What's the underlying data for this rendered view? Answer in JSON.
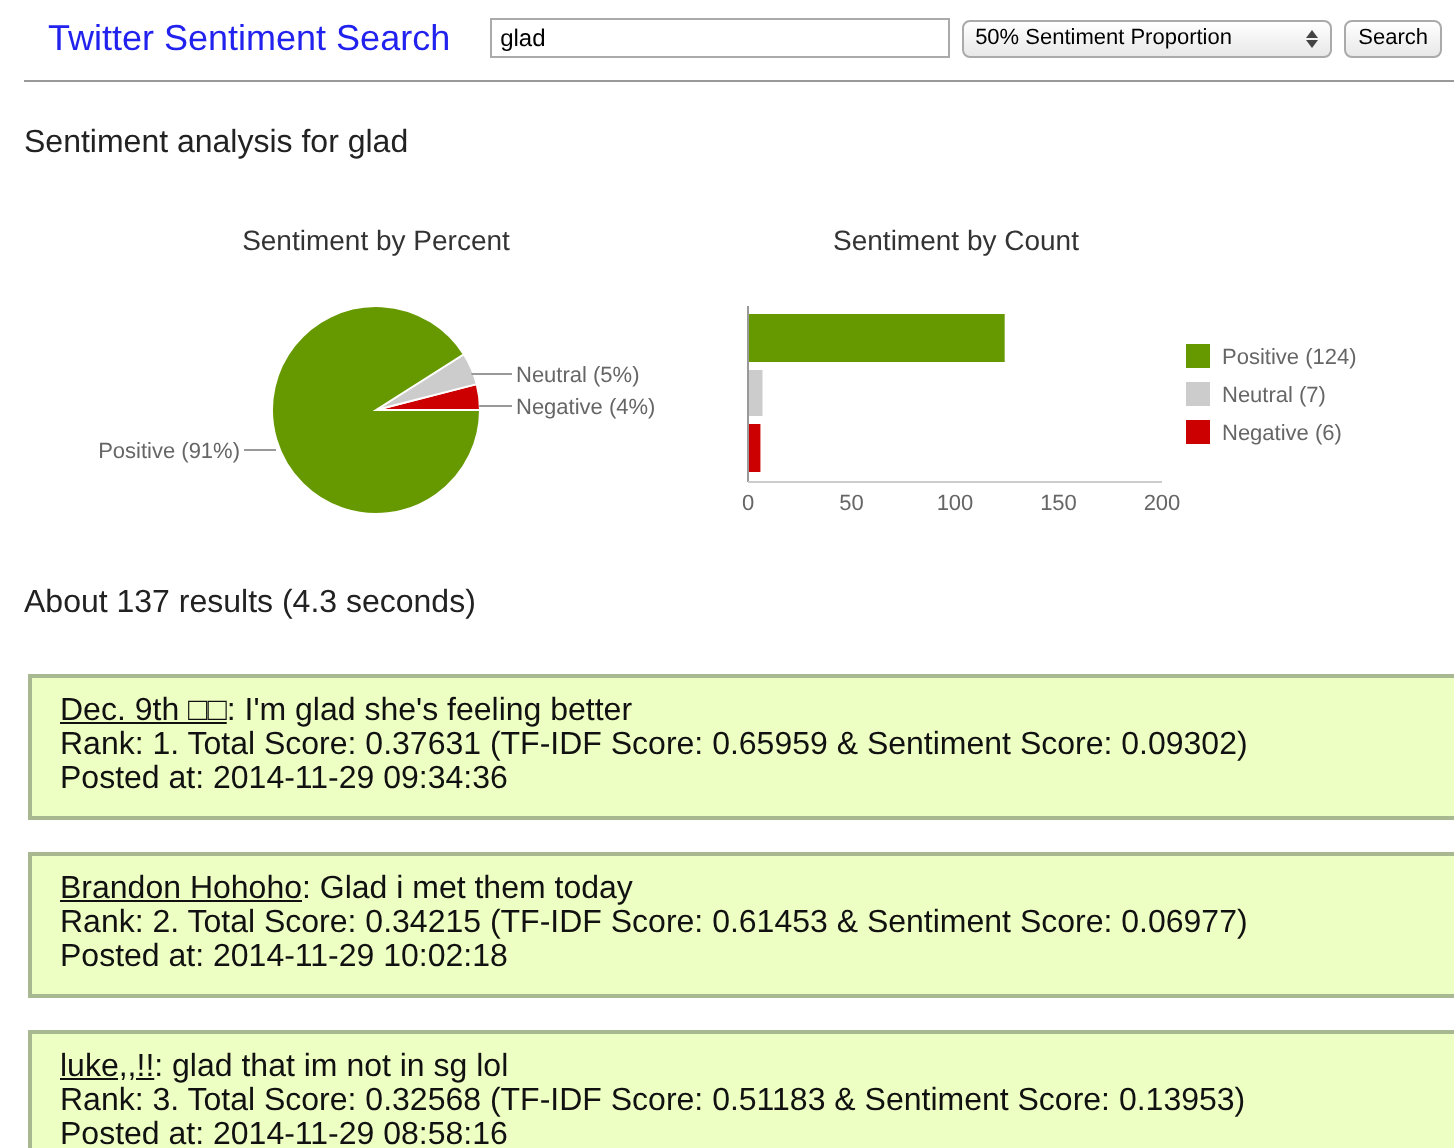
{
  "header": {
    "title": "Twitter Sentiment Search",
    "search": {
      "value": "glad"
    },
    "proportion_select": {
      "value": "50% Sentiment Proportion"
    },
    "search_button": "Search"
  },
  "analysis_heading": "Sentiment analysis for glad",
  "percent_chart": {
    "chart_data": {
      "type": "pie",
      "title": "Sentiment by Percent",
      "categories": [
        "Positive (91%)",
        "Neutral (5%)",
        "Negative (4%)"
      ],
      "series": [
        {
          "colors": [
            "#669900",
            "#cccccc",
            "#cc0000"
          ],
          "values": [
            91,
            5,
            4
          ]
        }
      ]
    }
  },
  "count_chart": {
    "chart_data": {
      "type": "bar",
      "orientation": "horizontal",
      "title": "Sentiment by Count",
      "categories": [
        "Positive (124)",
        "Neutral (7)",
        "Negative (6)"
      ],
      "series": [
        {
          "colors": [
            "#669900",
            "#cccccc",
            "#cc0000"
          ],
          "values": [
            124,
            7,
            6
          ]
        }
      ],
      "xlim": [
        0,
        200
      ],
      "xticks": [
        0,
        50,
        100,
        150,
        200
      ]
    }
  },
  "results_summary": "About 137 results (4.3 seconds)",
  "results": [
    {
      "user": "Dec. 9th □□",
      "text": ": I'm glad she's feeling better",
      "score_line": "Rank: 1. Total Score: 0.37631 (TF-IDF Score: 0.65959 & Sentiment Score: 0.09302)",
      "posted": "Posted at: 2014-11-29 09:34:36"
    },
    {
      "user": "Brandon Hohoho",
      "text": ": Glad i met them today",
      "score_line": "Rank: 2. Total Score: 0.34215 (TF-IDF Score: 0.61453 & Sentiment Score: 0.06977)",
      "posted": "Posted at: 2014-11-29 10:02:18"
    },
    {
      "user": "luke,,!!",
      "text": ": glad that im not in sg lol",
      "score_line": "Rank: 3. Total Score: 0.32568 (TF-IDF Score: 0.51183 & Sentiment Score: 0.13953)",
      "posted": "Posted at: 2014-11-29 08:58:16"
    }
  ]
}
